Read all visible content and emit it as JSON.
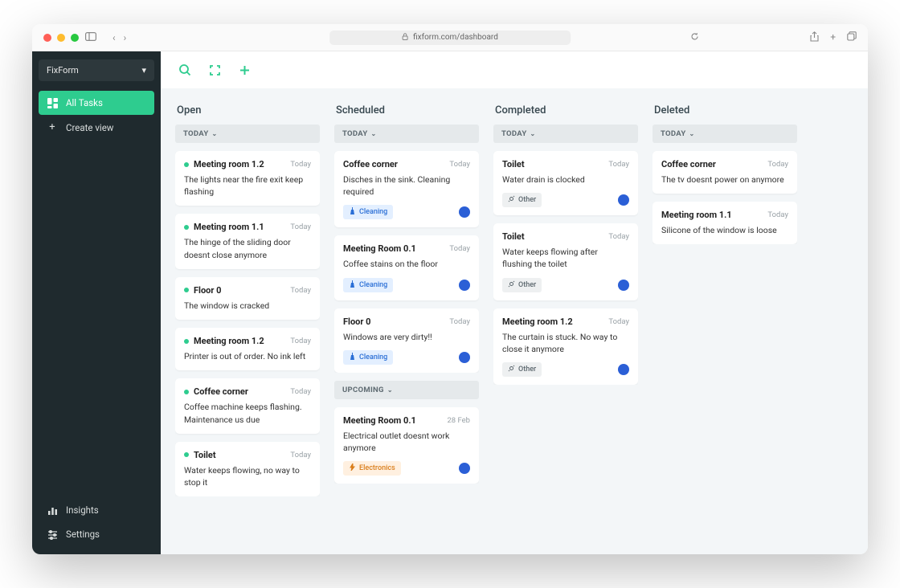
{
  "browser": {
    "url": "fixform.com/dashboard"
  },
  "sidebar": {
    "workspace": "FixForm",
    "items": [
      {
        "label": "All Tasks",
        "icon": "board",
        "active": true
      },
      {
        "label": "Create view",
        "icon": "plus",
        "active": false
      }
    ],
    "bottom": [
      {
        "label": "Insights",
        "icon": "bars"
      },
      {
        "label": "Settings",
        "icon": "sliders"
      }
    ]
  },
  "board": {
    "columns": [
      {
        "title": "Open",
        "groups": [
          {
            "label": "TODAY",
            "cards": [
              {
                "title": "Meeting room 1.2",
                "date": "Today",
                "desc": "The lights near the fire exit keep flashing",
                "dot": "green"
              },
              {
                "title": "Meeting room 1.1",
                "date": "Today",
                "desc": "The hinge of the sliding door doesnt close anymore",
                "dot": "green"
              },
              {
                "title": "Floor 0",
                "date": "Today",
                "desc": "The window is cracked",
                "dot": "green"
              },
              {
                "title": "Meeting room 1.2",
                "date": "Today",
                "desc": "Printer is out of order. No ink left",
                "dot": "green"
              },
              {
                "title": "Coffee corner",
                "date": "Today",
                "desc": "Coffee machine keeps flashing. Maintenance us due",
                "dot": "green"
              },
              {
                "title": "Toilet",
                "date": "Today",
                "desc": "Water keeps flowing, no way to stop it",
                "dot": "green"
              }
            ]
          }
        ]
      },
      {
        "title": "Scheduled",
        "groups": [
          {
            "label": "TODAY",
            "cards": [
              {
                "title": "Coffee corner",
                "date": "Today",
                "desc": "Disches in the sink. Cleaning required",
                "tag": "Cleaning",
                "tagType": "cleaning",
                "avatar": true
              },
              {
                "title": "Meeting Room 0.1",
                "date": "Today",
                "desc": "Coffee stains on the floor",
                "tag": "Cleaning",
                "tagType": "cleaning",
                "avatar": true
              },
              {
                "title": "Floor 0",
                "date": "Today",
                "desc": "Windows are very dirty!!",
                "tag": "Cleaning",
                "tagType": "cleaning",
                "avatar": true
              }
            ]
          },
          {
            "label": "UPCOMING",
            "cards": [
              {
                "title": "Meeting Room 0.1",
                "date": "28 Feb",
                "desc": "Electrical outlet doesnt work anymore",
                "tag": "Electronics",
                "tagType": "electronics",
                "avatar": true
              }
            ]
          }
        ]
      },
      {
        "title": "Completed",
        "groups": [
          {
            "label": "TODAY",
            "cards": [
              {
                "title": "Toilet",
                "date": "Today",
                "desc": "Water drain is clocked",
                "tag": "Other",
                "tagType": "other",
                "avatar": true
              },
              {
                "title": "Toilet",
                "date": "Today",
                "desc": "Water keeps flowing after flushing the toilet",
                "tag": "Other",
                "tagType": "other",
                "avatar": true
              },
              {
                "title": "Meeting room 1.2",
                "date": "Today",
                "desc": "The curtain is stuck. No way to close it anymore",
                "tag": "Other",
                "tagType": "other",
                "avatar": true
              }
            ]
          }
        ]
      },
      {
        "title": "Deleted",
        "groups": [
          {
            "label": "TODAY",
            "cards": [
              {
                "title": "Coffee corner",
                "date": "Today",
                "desc": "The tv doesnt power on anymore"
              },
              {
                "title": "Meeting room 1.1",
                "date": "Today",
                "desc": "Silicone of the window is loose"
              }
            ]
          }
        ]
      }
    ]
  }
}
